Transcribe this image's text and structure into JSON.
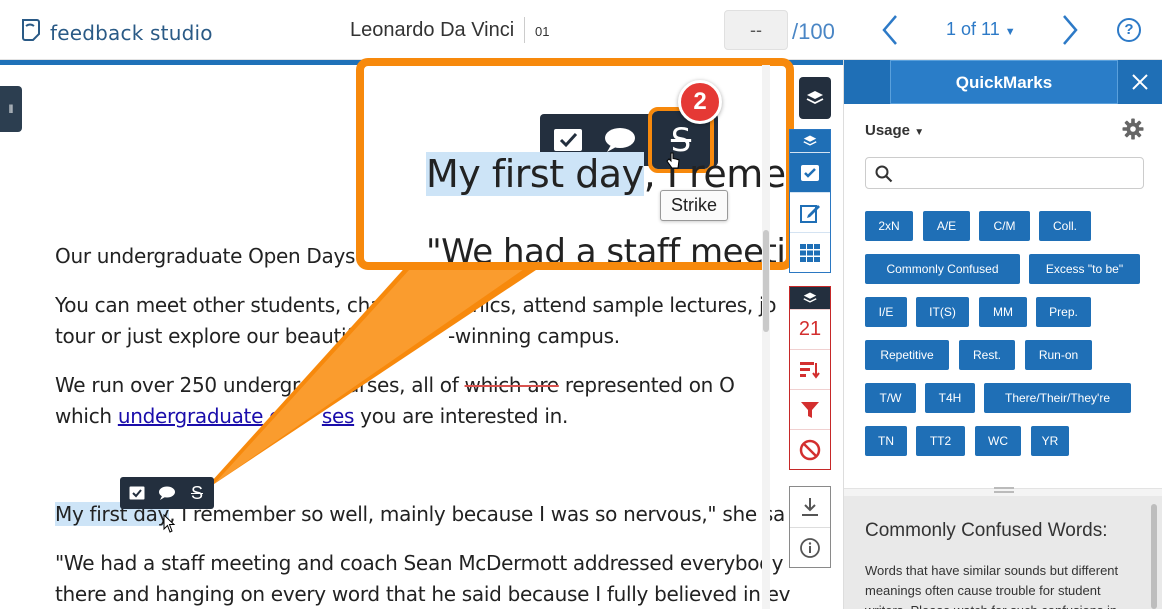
{
  "header": {
    "logo_text": "feedback studio",
    "student_name": "Leonardo Da Vinci",
    "paper_number": "01",
    "grade_value": "--",
    "grade_total": "/100",
    "paging_label": "1 of 11",
    "help_label": "?"
  },
  "document": {
    "paragraph1": "Our undergraduate Open Days",
    "paragraph2_line1": "You can meet other students, cha",
    "paragraph2_line1_end": "nics, attend sample lectures, jo",
    "paragraph2_line2_start": "tour or just explore our beautif",
    "paragraph2_line2_end": "-winning campus.",
    "paragraph3_line1_start": "We run over 250 undergr",
    "paragraph3_line1_mid": " courses, all of ",
    "paragraph3_line1_struck": "which are",
    "paragraph3_line1_end": " represented on O",
    "paragraph3_line2_start": "which ",
    "paragraph3_link1": "undergraduate",
    "paragraph3_space": " ",
    "paragraph3_link2": "c",
    "paragraph3_link3": "ses",
    "paragraph3_line2_end": " you are interested in.",
    "highlight_text": "My first day",
    "paragraph4_rest": ", I remember so well, mainly because I was so nervous,\" she sa",
    "paragraph5_line1": "\"We had a staff meeting and coach Sean McDermott addressed everybody",
    "paragraph5_line2": "there and hanging on every word that he said because I fully believed in ev"
  },
  "callout": {
    "zoom_highlight": "My first day",
    "zoom_rest": ", I rememb",
    "zoom_line2": "\"We had a staff meeti",
    "tooltip": "Strike",
    "step_number": "2"
  },
  "rail": {
    "count": "21"
  },
  "quickmarks": {
    "title": "QuickMarks",
    "usage_label": "Usage",
    "search_placeholder": "",
    "tags": [
      "2xN",
      "A/E",
      "C/M",
      "Coll.",
      "Commonly Confused",
      "Excess \"to be\"",
      "I/E",
      "IT(S)",
      "MM",
      "Prep.",
      "Repetitive",
      "Rest.",
      "Run-on",
      "T/W",
      "T4H",
      "There/Their/They're",
      "TN",
      "TT2",
      "WC",
      "YR"
    ],
    "detail_title": "Commonly Confused Words:",
    "detail_text": "Words that have similar sounds but different meanings often cause trouble for student writers. Please watch for such confusions in"
  },
  "colors": {
    "brand_blue": "#1f6fb6",
    "callout_orange": "#f7890c",
    "badge_red": "#e53935",
    "toolbar_dark": "#232f3e"
  }
}
